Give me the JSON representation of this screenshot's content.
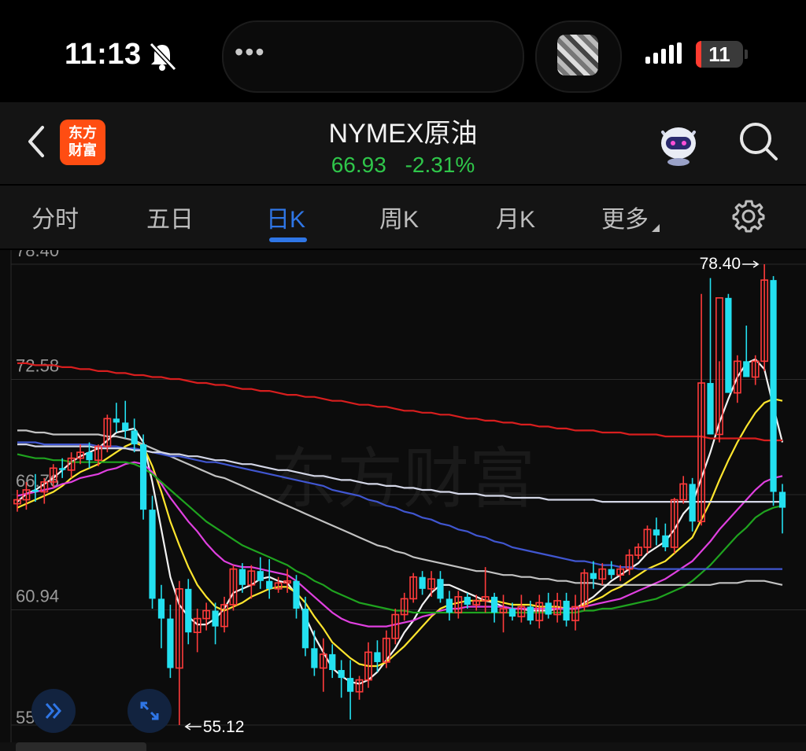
{
  "status_bar": {
    "time": "11:13",
    "island_dots": "•••",
    "battery": "11",
    "icons": [
      "bell-slash-icon",
      "album-art-icon",
      "signal-icon",
      "battery-icon"
    ]
  },
  "header": {
    "logo_line1": "东方",
    "logo_line2": "财富",
    "title": "NYMEX原油",
    "price": "66.93",
    "change": "-2.31%",
    "icons": [
      "back-chevron-icon",
      "robot-assistant-icon",
      "search-icon"
    ]
  },
  "tabs": {
    "items": [
      {
        "label": "分时",
        "active": false
      },
      {
        "label": "五日",
        "active": false
      },
      {
        "label": "日K",
        "active": true
      },
      {
        "label": "周K",
        "active": false
      },
      {
        "label": "月K",
        "active": false
      },
      {
        "label": "更多",
        "active": false
      }
    ],
    "settings_icon": "gear-icon"
  },
  "chart_data": {
    "type": "candlestick",
    "y_ticks": [
      "78.40",
      "72.58",
      "66.76",
      "60.94",
      "55.12"
    ],
    "ylim": [
      55.12,
      78.4
    ],
    "max_label": "78.40",
    "min_label": "55.12",
    "watermark": "东方财富",
    "colors": {
      "up": "#ff3b3b",
      "down": "#23e0f0"
    },
    "candles": [
      [
        66.3,
        67.0,
        65.9,
        66.5
      ],
      [
        66.5,
        67.4,
        66.0,
        67.0
      ],
      [
        67.0,
        67.8,
        66.4,
        66.9
      ],
      [
        66.9,
        67.6,
        66.3,
        67.4
      ],
      [
        67.4,
        68.3,
        67.1,
        68.1
      ],
      [
        68.1,
        68.6,
        67.6,
        68.0
      ],
      [
        68.0,
        68.9,
        67.6,
        68.6
      ],
      [
        68.6,
        69.3,
        68.3,
        68.9
      ],
      [
        68.9,
        69.4,
        68.1,
        68.5
      ],
      [
        68.5,
        69.3,
        68.2,
        69.2
      ],
      [
        69.2,
        70.8,
        68.9,
        70.6
      ],
      [
        70.6,
        71.4,
        69.9,
        70.4
      ],
      [
        70.4,
        71.5,
        69.6,
        70.0
      ],
      [
        70.0,
        70.6,
        68.9,
        69.3
      ],
      [
        69.3,
        69.8,
        65.5,
        66.0
      ],
      [
        66.0,
        66.7,
        61.0,
        61.5
      ],
      [
        61.5,
        62.2,
        59.0,
        60.5
      ],
      [
        60.5,
        61.2,
        57.5,
        58.0
      ],
      [
        58.0,
        62.4,
        55.12,
        62.0
      ],
      [
        62.0,
        62.5,
        59.2,
        59.8
      ],
      [
        59.8,
        61.0,
        58.8,
        60.5
      ],
      [
        60.5,
        61.3,
        59.9,
        60.9
      ],
      [
        60.9,
        61.3,
        59.2,
        60.1
      ],
      [
        60.1,
        61.6,
        59.8,
        61.2
      ],
      [
        61.2,
        63.2,
        60.9,
        63.0
      ],
      [
        63.0,
        63.3,
        61.8,
        62.2
      ],
      [
        62.2,
        63.2,
        61.5,
        62.9
      ],
      [
        62.9,
        63.6,
        62.0,
        62.4
      ],
      [
        62.4,
        63.5,
        61.5,
        62.0
      ],
      [
        62.0,
        62.6,
        61.8,
        62.3
      ],
      [
        62.3,
        63.0,
        61.8,
        62.4
      ],
      [
        62.4,
        62.7,
        60.5,
        61.0
      ],
      [
        61.0,
        61.6,
        58.6,
        59.0
      ],
      [
        59.0,
        59.9,
        57.6,
        58.0
      ],
      [
        58.0,
        59.5,
        56.8,
        58.7
      ],
      [
        58.7,
        59.2,
        57.5,
        57.9
      ],
      [
        57.9,
        58.4,
        56.5,
        57.5
      ],
      [
        57.5,
        58.4,
        55.4,
        56.8
      ],
      [
        56.8,
        57.6,
        56.4,
        57.4
      ],
      [
        57.4,
        59.3,
        57.0,
        58.8
      ],
      [
        58.8,
        59.4,
        57.8,
        58.3
      ],
      [
        58.3,
        59.9,
        58.0,
        59.5
      ],
      [
        59.5,
        61.0,
        59.2,
        60.7
      ],
      [
        60.7,
        61.8,
        60.4,
        61.5
      ],
      [
        61.5,
        62.8,
        61.3,
        62.6
      ],
      [
        62.6,
        62.9,
        61.7,
        62.0
      ],
      [
        62.0,
        62.9,
        61.6,
        62.5
      ],
      [
        62.5,
        62.9,
        61.3,
        61.5
      ],
      [
        61.5,
        61.9,
        60.4,
        60.8
      ],
      [
        60.8,
        61.9,
        60.5,
        61.6
      ],
      [
        61.6,
        61.8,
        61.0,
        61.2
      ],
      [
        61.2,
        61.7,
        60.9,
        61.4
      ],
      [
        61.4,
        63.1,
        60.8,
        61.6
      ],
      [
        61.6,
        61.8,
        60.3,
        60.8
      ],
      [
        60.8,
        61.7,
        59.8,
        61.0
      ],
      [
        61.0,
        61.3,
        60.4,
        60.6
      ],
      [
        60.6,
        61.7,
        60.3,
        61.1
      ],
      [
        61.1,
        61.4,
        60.2,
        60.4
      ],
      [
        60.4,
        61.7,
        60.0,
        61.3
      ],
      [
        61.3,
        61.8,
        60.5,
        60.7
      ],
      [
        60.7,
        61.8,
        60.3,
        61.4
      ],
      [
        61.4,
        61.8,
        60.1,
        60.4
      ],
      [
        60.4,
        61.7,
        59.9,
        61.1
      ],
      [
        61.1,
        63.0,
        60.9,
        62.8
      ],
      [
        62.8,
        63.4,
        62.0,
        62.5
      ],
      [
        62.5,
        63.3,
        62.2,
        63.0
      ],
      [
        63.0,
        63.4,
        62.5,
        62.7
      ],
      [
        62.7,
        63.2,
        62.4,
        63.0
      ],
      [
        63.0,
        64.0,
        62.7,
        63.7
      ],
      [
        63.7,
        64.3,
        63.5,
        64.1
      ],
      [
        64.1,
        65.2,
        63.8,
        65.0
      ],
      [
        65.0,
        65.6,
        64.2,
        64.7
      ],
      [
        64.7,
        65.3,
        63.9,
        64.1
      ],
      [
        64.1,
        66.6,
        63.8,
        66.5
      ],
      [
        66.5,
        67.7,
        66.3,
        67.3
      ],
      [
        67.3,
        67.6,
        64.9,
        65.4
      ],
      [
        65.4,
        76.9,
        65.2,
        72.4
      ],
      [
        72.4,
        77.7,
        71.3,
        69.8
      ],
      [
        69.8,
        73.5,
        69.4,
        76.7
      ],
      [
        76.7,
        76.9,
        72.0,
        71.9
      ],
      [
        71.9,
        73.8,
        71.4,
        73.5
      ],
      [
        73.5,
        75.3,
        72.8,
        72.7
      ],
      [
        72.7,
        73.8,
        72.3,
        73.5
      ],
      [
        73.5,
        78.4,
        73.0,
        77.6
      ],
      [
        77.6,
        77.8,
        66.2,
        66.9
      ],
      [
        66.9,
        67.3,
        64.8,
        66.1
      ]
    ],
    "ma_lines": [
      {
        "color": "#f2f2f2",
        "values": [
          66.4,
          66.8,
          67.0,
          67.3,
          67.6,
          68.0,
          68.4,
          68.7,
          68.9,
          69.1,
          69.5,
          69.9,
          70.0,
          70.1,
          69.4,
          67.4,
          65.0,
          62.6,
          61.2,
          60.6,
          60.2,
          60.2,
          60.5,
          61.0,
          61.8,
          62.0,
          62.2,
          62.5,
          62.6,
          62.4,
          62.3,
          61.7,
          60.6,
          59.6,
          58.8,
          58.0,
          57.6,
          57.3,
          57.2,
          57.4,
          57.8,
          58.4,
          59.0,
          59.8,
          60.4,
          61.2,
          61.8,
          62.2,
          62.2,
          62.0,
          61.8,
          61.6,
          61.4,
          61.3,
          61.1,
          61.0,
          61.0,
          60.9,
          60.9,
          60.9,
          61.0,
          61.0,
          61.0,
          61.3,
          61.6,
          62.0,
          62.4,
          62.7,
          63.0,
          63.3,
          63.8,
          64.1,
          64.4,
          65.0,
          65.8,
          66.3,
          67.6,
          68.9,
          70.4,
          71.6,
          72.7,
          73.4,
          73.6,
          73.1,
          71.2,
          69.4
        ]
      },
      {
        "color": "#ffe62e",
        "values": [
          66.1,
          66.3,
          66.5,
          66.7,
          66.9,
          67.2,
          67.6,
          67.9,
          68.1,
          68.3,
          68.6,
          68.9,
          69.2,
          69.4,
          69.2,
          68.2,
          66.9,
          65.4,
          64.2,
          63.1,
          62.2,
          61.6,
          61.1,
          60.9,
          61.1,
          61.3,
          61.6,
          61.8,
          62.0,
          62.1,
          62.1,
          61.8,
          61.3,
          60.6,
          60.0,
          59.3,
          58.9,
          58.5,
          58.2,
          58.1,
          58.1,
          58.3,
          58.7,
          59.1,
          59.6,
          60.1,
          60.6,
          61.0,
          61.2,
          61.3,
          61.4,
          61.4,
          61.4,
          61.4,
          61.3,
          61.2,
          61.2,
          61.2,
          61.1,
          61.1,
          61.1,
          61.0,
          61.0,
          61.2,
          61.4,
          61.6,
          61.9,
          62.1,
          62.4,
          62.7,
          63.0,
          63.2,
          63.4,
          63.8,
          64.2,
          64.6,
          65.5,
          66.4,
          67.5,
          68.5,
          69.4,
          70.2,
          70.9,
          71.4,
          71.6,
          71.5
        ]
      },
      {
        "color": "#e040e0",
        "values": [
          66.7,
          66.8,
          66.9,
          67.0,
          67.1,
          67.3,
          67.4,
          67.6,
          67.7,
          67.8,
          68.0,
          68.1,
          68.3,
          68.4,
          68.3,
          67.9,
          67.3,
          66.6,
          66.0,
          65.4,
          64.9,
          64.3,
          63.8,
          63.4,
          63.2,
          63.1,
          63.1,
          63.0,
          62.9,
          62.8,
          62.7,
          62.4,
          62.0,
          61.6,
          61.2,
          60.8,
          60.5,
          60.3,
          60.2,
          60.1,
          60.1,
          60.1,
          60.2,
          60.3,
          60.4,
          60.6,
          60.7,
          60.9,
          61.0,
          61.0,
          61.1,
          61.1,
          61.1,
          61.1,
          61.1,
          61.0,
          61.0,
          61.0,
          61.0,
          61.0,
          61.0,
          61.0,
          61.0,
          61.1,
          61.2,
          61.3,
          61.4,
          61.5,
          61.7,
          61.9,
          62.1,
          62.3,
          62.5,
          62.8,
          63.1,
          63.4,
          63.9,
          64.4,
          65.0,
          65.5,
          66.0,
          66.5,
          67.0,
          67.4,
          67.6,
          67.7
        ]
      },
      {
        "color": "#1fa31f",
        "values": [
          68.8,
          68.7,
          68.6,
          68.6,
          68.5,
          68.5,
          68.4,
          68.4,
          68.4,
          68.4,
          68.4,
          68.4,
          68.4,
          68.3,
          68.1,
          67.8,
          67.4,
          67.0,
          66.6,
          66.2,
          65.8,
          65.4,
          65.1,
          64.8,
          64.5,
          64.2,
          64.0,
          63.8,
          63.6,
          63.4,
          63.2,
          62.9,
          62.7,
          62.4,
          62.2,
          61.9,
          61.7,
          61.5,
          61.3,
          61.2,
          61.1,
          61.0,
          60.9,
          60.9,
          60.8,
          60.8,
          60.8,
          60.8,
          60.8,
          60.8,
          60.8,
          60.8,
          60.8,
          60.8,
          60.8,
          60.8,
          60.8,
          60.8,
          60.8,
          60.8,
          60.8,
          60.8,
          60.8,
          60.9,
          60.9,
          61.0,
          61.0,
          61.1,
          61.2,
          61.3,
          61.4,
          61.5,
          61.7,
          61.9,
          62.1,
          62.4,
          62.8,
          63.2,
          63.7,
          64.2,
          64.7,
          65.1,
          65.6,
          65.9,
          66.1,
          66.2
        ]
      },
      {
        "color": "#ffffff",
        "opacity": 0.75,
        "values": [
          70.0,
          70.0,
          69.9,
          69.9,
          69.8,
          69.8,
          69.8,
          69.8,
          69.8,
          69.8,
          69.7,
          69.7,
          69.6,
          69.5,
          69.3,
          69.1,
          68.9,
          68.7,
          68.5,
          68.3,
          68.1,
          67.9,
          67.7,
          67.6,
          67.4,
          67.2,
          67.0,
          66.8,
          66.6,
          66.4,
          66.2,
          66.0,
          65.8,
          65.6,
          65.4,
          65.2,
          65.0,
          64.8,
          64.6,
          64.4,
          64.2,
          64.1,
          63.9,
          63.8,
          63.6,
          63.5,
          63.4,
          63.3,
          63.2,
          63.1,
          63.0,
          62.9,
          62.9,
          62.8,
          62.7,
          62.7,
          62.6,
          62.6,
          62.5,
          62.5,
          62.4,
          62.4,
          62.3,
          62.3,
          62.3,
          62.2,
          62.2,
          62.2,
          62.2,
          62.2,
          62.2,
          62.2,
          62.2,
          62.2,
          62.2,
          62.2,
          62.2,
          62.2,
          62.3,
          62.3,
          62.3,
          62.4,
          62.4,
          62.4,
          62.3,
          62.2
        ]
      },
      {
        "color": "#4056d0",
        "values": [
          69.4,
          69.4,
          69.4,
          69.3,
          69.3,
          69.3,
          69.3,
          69.3,
          69.3,
          69.2,
          69.2,
          69.2,
          69.1,
          69.1,
          69.0,
          68.9,
          68.8,
          68.7,
          68.7,
          68.6,
          68.5,
          68.4,
          68.4,
          68.3,
          68.2,
          68.1,
          68.0,
          67.9,
          67.8,
          67.7,
          67.6,
          67.5,
          67.4,
          67.3,
          67.2,
          67.0,
          66.9,
          66.8,
          66.7,
          66.5,
          66.4,
          66.2,
          66.1,
          65.9,
          65.8,
          65.6,
          65.5,
          65.3,
          65.2,
          65.0,
          64.9,
          64.7,
          64.6,
          64.4,
          64.3,
          64.1,
          64.0,
          63.9,
          63.8,
          63.7,
          63.6,
          63.5,
          63.4,
          63.4,
          63.3,
          63.2,
          63.2,
          63.1,
          63.1,
          63.0,
          63.0,
          63.0,
          63.0,
          63.0,
          63.0,
          63.0,
          63.0,
          63.0,
          63.0,
          63.0,
          63.0,
          63.0,
          63.0,
          63.0,
          63.0,
          63.0
        ]
      },
      {
        "color": "#d3d6e6",
        "values": [
          69.3,
          69.3,
          69.2,
          69.2,
          69.2,
          69.2,
          69.2,
          69.2,
          69.2,
          69.1,
          69.1,
          69.1,
          69.1,
          69.0,
          69.0,
          68.9,
          68.9,
          68.8,
          68.8,
          68.7,
          68.7,
          68.6,
          68.5,
          68.5,
          68.4,
          68.3,
          68.3,
          68.2,
          68.1,
          68.0,
          68.0,
          67.9,
          67.8,
          67.7,
          67.7,
          67.6,
          67.5,
          67.5,
          67.4,
          67.3,
          67.3,
          67.2,
          67.2,
          67.1,
          67.1,
          67.0,
          67.0,
          66.9,
          66.9,
          66.8,
          66.8,
          66.8,
          66.7,
          66.7,
          66.7,
          66.6,
          66.6,
          66.6,
          66.6,
          66.5,
          66.5,
          66.5,
          66.5,
          66.5,
          66.5,
          66.4,
          66.4,
          66.4,
          66.4,
          66.4,
          66.4,
          66.4,
          66.4,
          66.4,
          66.4,
          66.4,
          66.4,
          66.4,
          66.4,
          66.4,
          66.4,
          66.4,
          66.4,
          66.4,
          66.4,
          66.4
        ]
      },
      {
        "color": "#d81e1e",
        "values": [
          73.4,
          73.4,
          73.3,
          73.3,
          73.3,
          73.2,
          73.2,
          73.1,
          73.1,
          73.0,
          73.0,
          72.9,
          72.9,
          72.8,
          72.8,
          72.7,
          72.7,
          72.6,
          72.6,
          72.5,
          72.4,
          72.4,
          72.3,
          72.3,
          72.2,
          72.1,
          72.1,
          72.0,
          72.0,
          71.9,
          71.8,
          71.8,
          71.7,
          71.7,
          71.6,
          71.5,
          71.5,
          71.4,
          71.3,
          71.3,
          71.2,
          71.2,
          71.1,
          71.0,
          71.0,
          70.9,
          70.9,
          70.8,
          70.8,
          70.7,
          70.6,
          70.6,
          70.5,
          70.5,
          70.4,
          70.4,
          70.3,
          70.3,
          70.2,
          70.2,
          70.1,
          70.1,
          70.0,
          70.0,
          70.0,
          69.9,
          69.9,
          69.9,
          69.8,
          69.8,
          69.8,
          69.8,
          69.7,
          69.7,
          69.7,
          69.7,
          69.7,
          69.6,
          69.6,
          69.6,
          69.6,
          69.6,
          69.6,
          69.5,
          69.5,
          69.5
        ]
      }
    ]
  },
  "floating_buttons": [
    "double-chevron-right-icon",
    "expand-arrows-icon"
  ]
}
